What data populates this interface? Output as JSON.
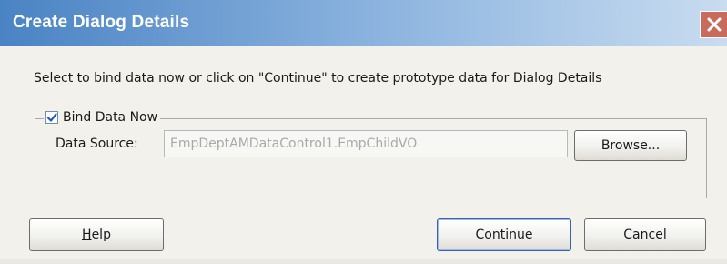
{
  "window": {
    "title": "Create Dialog Details",
    "close_icon": "close-icon",
    "title_gradient": [
      "#4a83c4",
      "#c9dcf0"
    ],
    "close_button_color": "#c86b5a"
  },
  "instruction": "Select to bind data now or click on \"Continue\" to create prototype data for Dialog Details",
  "bind_group": {
    "checkbox_label": "Bind Data Now",
    "checked": true,
    "data_source_label": "Data Source:",
    "data_source_value": "EmpDeptAMDataControl1.EmpChildVO",
    "browse_label": "Browse..."
  },
  "buttons": {
    "help_mnemonic": "H",
    "help_rest": "elp",
    "continue_label": "Continue",
    "cancel_label": "Cancel"
  }
}
